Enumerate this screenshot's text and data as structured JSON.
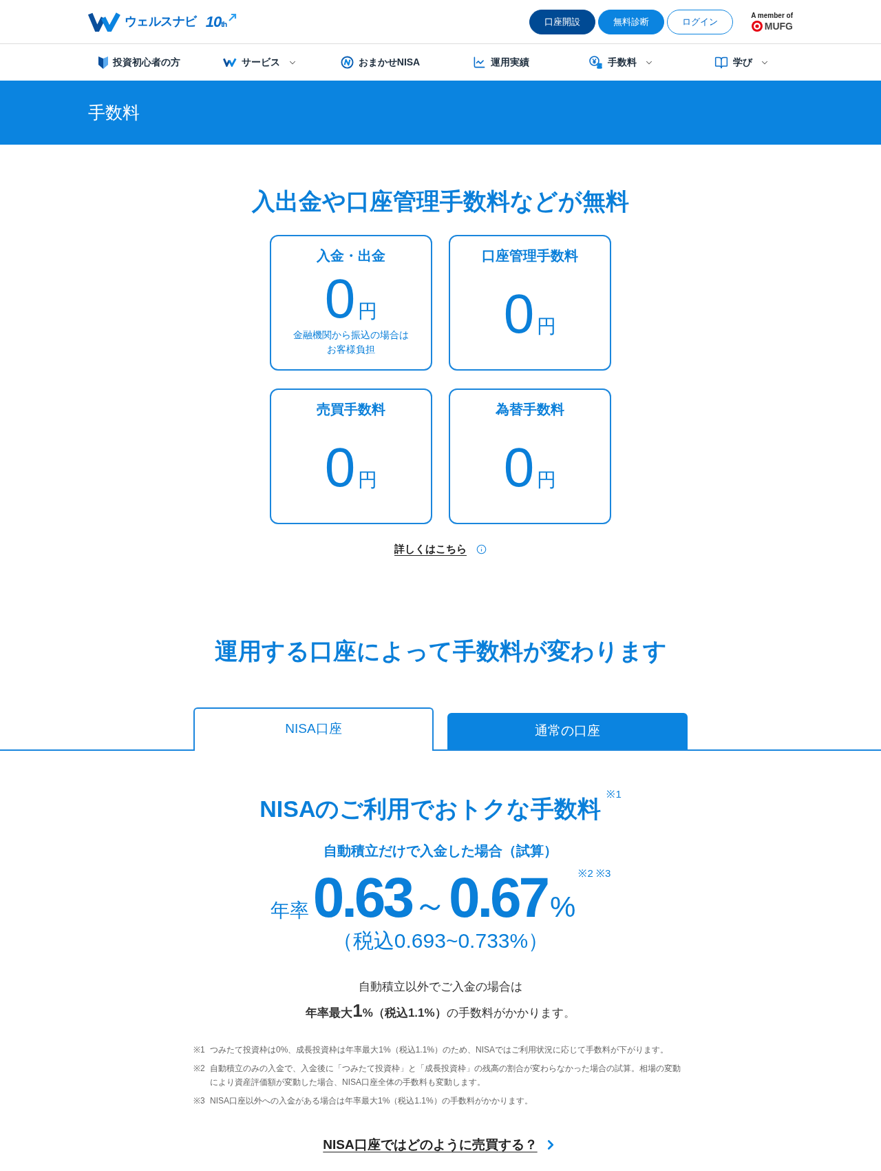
{
  "header": {
    "logo": {
      "name": "ウェルスナビ",
      "badge": "10",
      "badge_suffix": "th"
    },
    "buttons": [
      {
        "label": "口座開設",
        "kind": "dark"
      },
      {
        "label": "無料診断",
        "kind": "primary"
      },
      {
        "label": "ログイン",
        "kind": "outline"
      }
    ],
    "member": {
      "caption": "A member of",
      "brand": "MUFG"
    }
  },
  "nav": [
    {
      "label": "投資初心者の方",
      "has_menu": false
    },
    {
      "label": "サービス",
      "has_menu": true
    },
    {
      "label": "おまかせNISA",
      "has_menu": false
    },
    {
      "label": "運用実績",
      "has_menu": false
    },
    {
      "label": "手数料",
      "has_menu": true
    },
    {
      "label": "学び",
      "has_menu": true
    }
  ],
  "page_title": "手数料",
  "free_section": {
    "heading": "入出金や口座管理手数料などが無料",
    "cards": [
      {
        "title": "入金・出金",
        "amount": "0",
        "unit": "円",
        "note": "金融機関から振込の場合はお客様負担"
      },
      {
        "title": "口座管理手数料",
        "amount": "0",
        "unit": "円"
      },
      {
        "title": "売買手数料",
        "amount": "0",
        "unit": "円"
      },
      {
        "title": "為替手数料",
        "amount": "0",
        "unit": "円"
      }
    ],
    "link": "詳しくはこちら"
  },
  "account_section": {
    "heading": "運用する口座によって手数料が変わります",
    "tabs": [
      {
        "label": "NISA口座",
        "selected": true
      },
      {
        "label": "通常の口座",
        "selected": false
      }
    ],
    "panel": {
      "heading": "NISAのご利用でおトクな手数料$^{※1}$",
      "subheading": "自動積立だけで入金した場合（試算）",
      "rate": {
        "prefix": "年率",
        "from": "0.63",
        "separator": "～",
        "to": "0.67",
        "unit": "%",
        "notes": "※2 ※3"
      },
      "tax_included": "（税込0.693~0.733%）",
      "other_deposit": {
        "intro": "自動積立以外でご入金の場合は",
        "segments": [
          {
            "text": "年率最大",
            "kind": "strong"
          },
          {
            "text": "1",
            "kind": "figure"
          },
          {
            "text": "%（税込1.1%）",
            "kind": "strong"
          },
          {
            "text": "の手数料がかかります。",
            "kind": "plain"
          }
        ]
      },
      "footnotes": [
        {
          "mark": "※1",
          "text": "つみたて投資枠は0%、成長投資枠は年率最大1%（税込1.1%）のため、NISAではご利用状況に応じて手数料が下がります。"
        },
        {
          "mark": "※2",
          "text": "自動積立のみの入金で、入金後に「つみたて投資枠」と「成長投資枠」の残高の割合が変わらなかった場合の試算。相場の変動により資産評価額が変動した場合、NISA口座全体の手数料も変動します。"
        },
        {
          "mark": "※3",
          "text": "NISA口座以外への入金がある場合は年率最大1%（税込1.1%）の手数料がかかります。"
        }
      ],
      "link": "NISA口座ではどのように売買する？"
    }
  }
}
